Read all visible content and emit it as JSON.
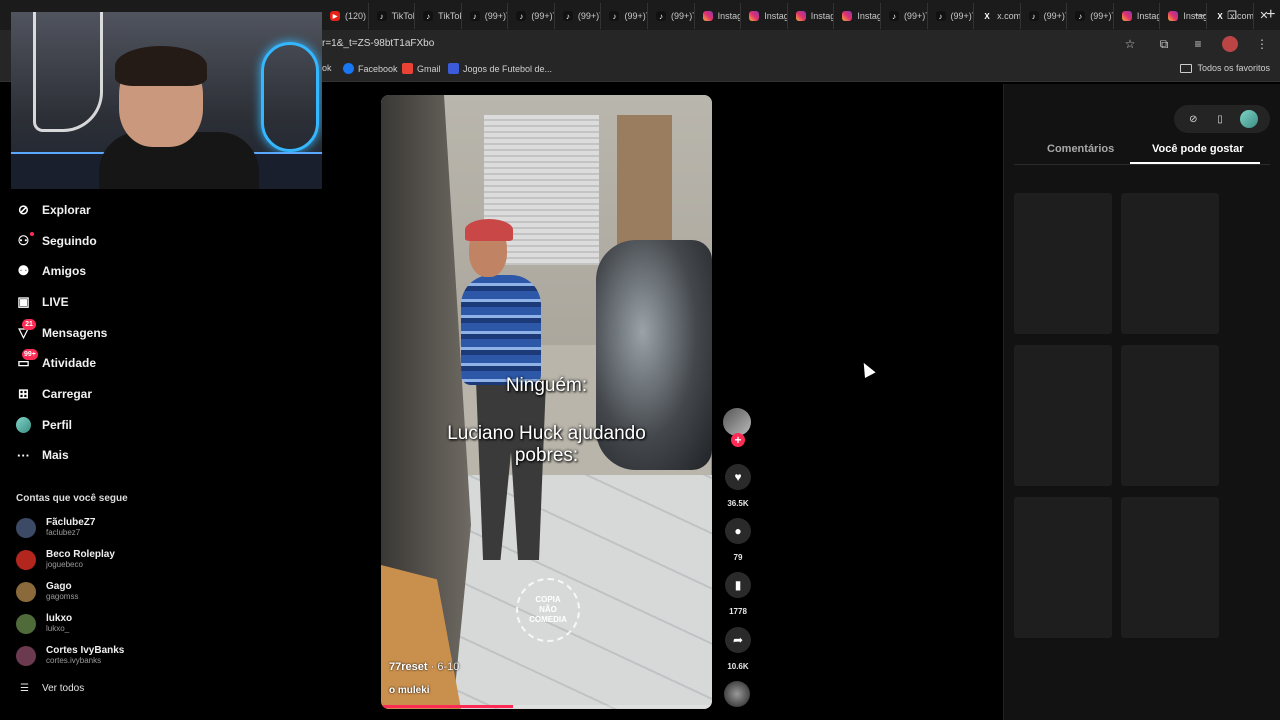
{
  "browser": {
    "tabs": [
      {
        "label": "(120) Y",
        "icon": "youtube-icon"
      },
      {
        "label": "TikTok",
        "icon": "tiktok-icon"
      },
      {
        "label": "TikTok",
        "icon": "tiktok-icon"
      },
      {
        "label": "(99+)T",
        "icon": "tiktok-icon"
      },
      {
        "label": "(99+)T",
        "icon": "tiktok-icon"
      },
      {
        "label": "(99+)Ti",
        "icon": "tiktok-icon"
      },
      {
        "label": "(99+)Ti",
        "icon": "tiktok-icon"
      },
      {
        "label": "(99+)Ti",
        "icon": "tiktok-icon"
      },
      {
        "label": "Instagr",
        "icon": "instagram-icon"
      },
      {
        "label": "Instagr",
        "icon": "instagram-icon"
      },
      {
        "label": "Instagr",
        "icon": "instagram-icon"
      },
      {
        "label": "Instagr",
        "icon": "instagram-icon"
      },
      {
        "label": "(99+)Ti",
        "icon": "tiktok-icon"
      },
      {
        "label": "(99+)Ti",
        "icon": "tiktok-icon"
      },
      {
        "label": "x.com/i",
        "icon": "x-icon"
      },
      {
        "label": "(99+)Ti",
        "icon": "tiktok-icon"
      },
      {
        "label": "(99+)Ti",
        "icon": "tiktok-icon"
      },
      {
        "label": "Instagr",
        "icon": "instagram-icon"
      },
      {
        "label": "Instagr",
        "icon": "instagram-icon"
      },
      {
        "label": "x.com/i",
        "icon": "x-icon"
      }
    ],
    "url": "r=1&_t=ZS-98btT1aFXbo",
    "bookmarks": {
      "partial": "ok",
      "facebook": "Facebook",
      "gmail": "Gmail",
      "jogos": "Jogos de Futebol de...",
      "all_favorites": "Todos os favoritos"
    }
  },
  "sidebar": {
    "nav": [
      {
        "label": "Explorar",
        "icon": "compass-icon"
      },
      {
        "label": "Seguindo",
        "icon": "following-icon"
      },
      {
        "label": "Amigos",
        "icon": "friends-icon"
      },
      {
        "label": "LIVE",
        "icon": "live-icon"
      },
      {
        "label": "Mensagens",
        "icon": "messages-icon",
        "badge": "21"
      },
      {
        "label": "Atividade",
        "icon": "activity-icon",
        "badge": "99+"
      },
      {
        "label": "Carregar",
        "icon": "upload-icon"
      },
      {
        "label": "Perfil",
        "icon": "profile-icon"
      },
      {
        "label": "Mais",
        "icon": "more-icon"
      }
    ],
    "following_title": "Contas que você segue",
    "accounts": [
      {
        "name": "FãclubeZ7",
        "user": "faclubez7",
        "color": "#3c4a66"
      },
      {
        "name": "Beco Roleplay",
        "user": "joguebeco",
        "color": "#b3261e"
      },
      {
        "name": "Gago",
        "user": "gagomss",
        "color": "#8a6a3a"
      },
      {
        "name": "lukxo",
        "user": "lukxo_",
        "color": "#4f6b3a"
      },
      {
        "name": "Cortes IvyBanks",
        "user": "cortes.ivybanks",
        "color": "#6b3a4f"
      }
    ],
    "see_all": "Ver todos"
  },
  "video": {
    "overlay_top": "Ninguém:",
    "overlay_line1": "Luciano Huck ajudando",
    "overlay_line2": "pobres:",
    "watermark": "COPIA\nNÃO\nCOMEDIA",
    "author": "77reset",
    "date": " · 6-10",
    "caption": "o muleki",
    "progress": 0.4
  },
  "actions": {
    "likes": "36.5K",
    "comments": "79",
    "saves": "1778",
    "shares": "10.6K"
  },
  "right_panel": {
    "tab_comments": "Comentários",
    "tab_you_may_like": "Você pode gostar"
  },
  "colors": {
    "accent": "#fe2c55",
    "background": "#000000",
    "panel": "#121212"
  }
}
